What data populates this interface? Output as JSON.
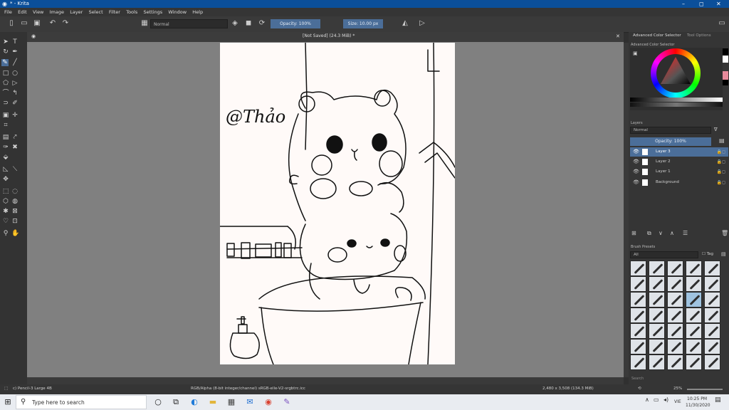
{
  "window": {
    "title": "* - Krita",
    "minimize": "–",
    "maximize": "◻",
    "close": "✕"
  },
  "menu": [
    "File",
    "Edit",
    "View",
    "Image",
    "Layer",
    "Select",
    "Filter",
    "Tools",
    "Settings",
    "Window",
    "Help"
  ],
  "toolbar": {
    "blend_mode": "Normal",
    "opacity": "Opacity: 100%",
    "size": "Size: 10.00 px"
  },
  "document": {
    "tab_title": "[Not Saved]  (24.3 MiB) *",
    "signature_text": "@Thảo"
  },
  "right_panel": {
    "tabs": [
      "Advanced Color Selector",
      "Tool Options"
    ],
    "color_selector_title": "Advanced Color Selector",
    "layers_title": "Layers",
    "layer_blend": "Normal",
    "layer_opacity": "Opacity:  100%",
    "layers": [
      "Layer 3",
      "Layer 2",
      "Layer 1",
      "Background"
    ],
    "brush_presets_title": "Brush Presets",
    "brush_filter": "All",
    "brush_tag": "Tag",
    "search_placeholder": "Search"
  },
  "status": {
    "brush": "c) Pencil-3 Large 4B",
    "colorspace": "RGB/Alpha (8-bit integer/channel)  sRGB-elle-V2-srgbtrc.icc",
    "image_size": "2,480 x 3,508 (134.3 MiB)",
    "zoom": "25%"
  },
  "taskbar": {
    "search_placeholder": "Type here to search",
    "time": "10:25 PM",
    "date": "11/30/2020",
    "lang": "VIE"
  },
  "colors": {
    "title_bar": "#0b4f9a",
    "accent": "#4b6e99",
    "canvas_bg": "#808080"
  }
}
